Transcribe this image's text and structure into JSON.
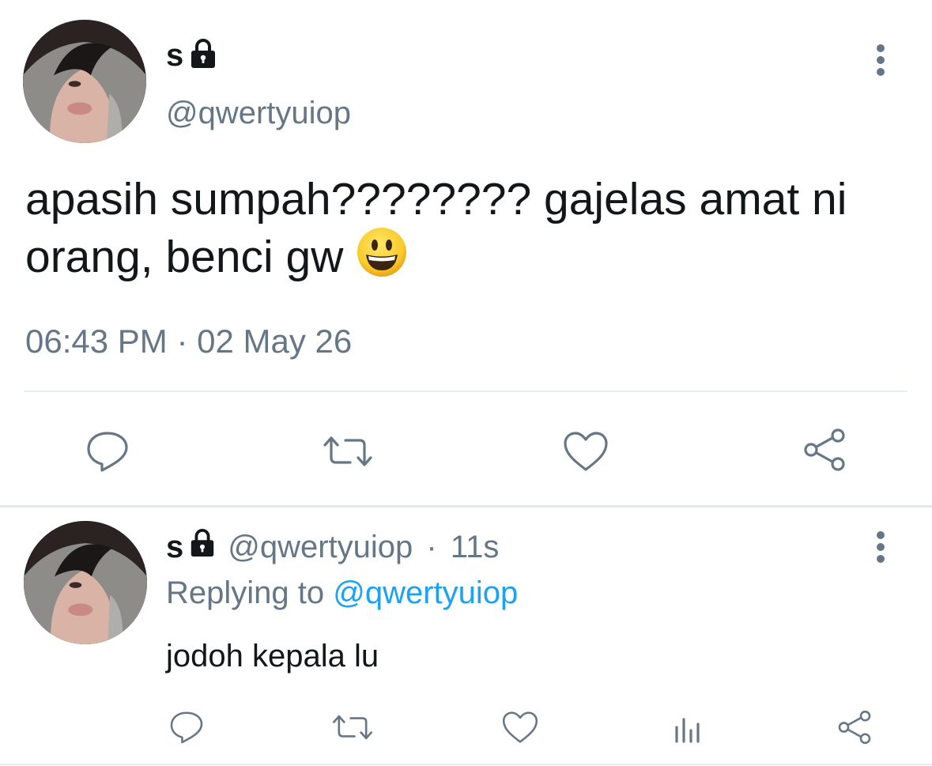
{
  "tweet": {
    "author_name": "s",
    "author_handle": "@qwertyuiop",
    "text": "apasih sumpah???????? gajelas amat ni orang, benci gw",
    "emoji_icon": "grinning-face-emoji",
    "timestamp": "06:43 PM · 02 May 26",
    "actions": [
      "reply-icon",
      "retweet-icon",
      "like-icon",
      "share-icon"
    ]
  },
  "reply": {
    "author_name": "s",
    "author_handle": "@qwertyuiop",
    "age_separator": " · ",
    "age": "11s",
    "replying_prefix": "Replying to ",
    "replying_to": "@qwertyuiop",
    "text": "jodoh kepala lu",
    "actions": [
      "reply-icon",
      "retweet-icon",
      "like-icon",
      "analytics-icon",
      "share-icon"
    ]
  },
  "colors": {
    "secondary_text": "#657786",
    "link": "#1da1f2",
    "primary_text": "#14171a"
  }
}
